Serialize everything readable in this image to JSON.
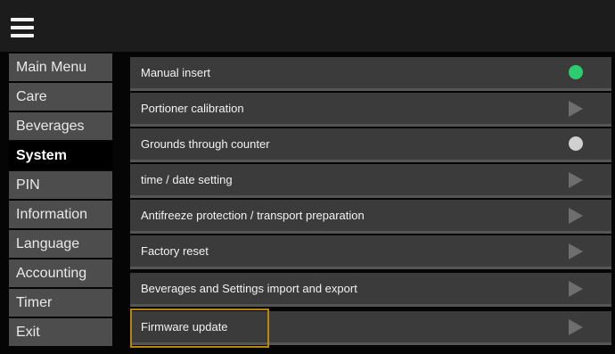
{
  "header": {
    "menu_icon": "hamburger-menu-icon"
  },
  "sidebar": {
    "items": [
      {
        "label": "Main Menu",
        "active": false
      },
      {
        "label": "Care",
        "active": false
      },
      {
        "label": "Beverages",
        "active": false
      },
      {
        "label": "System",
        "active": true
      },
      {
        "label": "PIN",
        "active": false
      },
      {
        "label": "Information",
        "active": false
      },
      {
        "label": "Language",
        "active": false
      },
      {
        "label": "Accounting",
        "active": false
      },
      {
        "label": "Timer",
        "active": false
      },
      {
        "label": "Exit",
        "active": false
      }
    ]
  },
  "system": {
    "rows": [
      {
        "label": "Manual insert",
        "indicator": "toggle-on-dot",
        "color": "#2ecc71"
      },
      {
        "label": "Portioner calibration",
        "indicator": "chevron-right-icon"
      },
      {
        "label": "Grounds through counter",
        "indicator": "toggle-off-dot",
        "color": "#d0d0d0"
      },
      {
        "label": "time / date setting",
        "indicator": "chevron-right-icon"
      },
      {
        "label": "Antifreeze protection / transport preparation",
        "indicator": "chevron-right-icon"
      },
      {
        "label": "Factory reset",
        "indicator": "chevron-right-icon"
      },
      {
        "label": "Beverages and Settings import and export",
        "indicator": "chevron-right-icon"
      },
      {
        "label": "Firmware update",
        "indicator": "chevron-right-icon",
        "highlighted": true
      }
    ]
  },
  "colors": {
    "highlight_border": "#b8860b",
    "row_bg": "#3b3b3b",
    "sidebar_bg": "#4d4d4d"
  }
}
